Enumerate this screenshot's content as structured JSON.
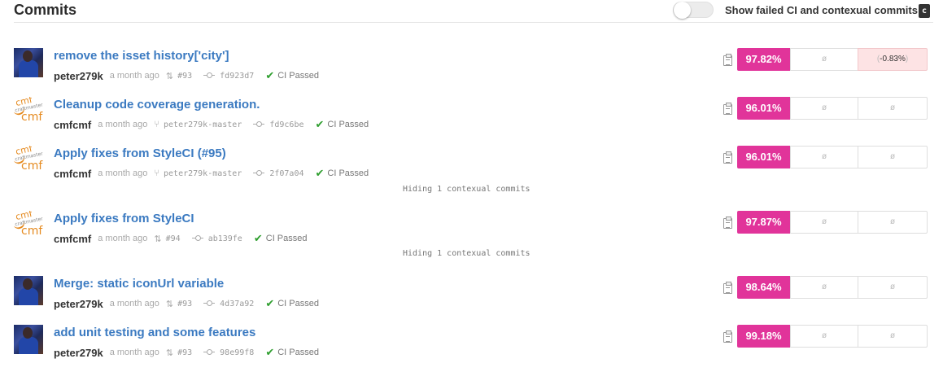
{
  "header": {
    "title": "Commits",
    "toggle_label": "Show failed CI and contexual commits",
    "shortcut_key": "c",
    "toggle_on": false
  },
  "commits": [
    {
      "title": "remove the isset history['city']",
      "author": "peter279k",
      "avatar": "photo",
      "time": "a month ago",
      "ref_icon": "pull-request-icon",
      "ref": "#93",
      "sha": "fd923d7",
      "ci": "CI Passed",
      "coverage": "97.82%",
      "col2": "ø",
      "col3": "-0.83%",
      "col3_negative": true
    },
    {
      "title": "Cleanup code coverage generation.",
      "author": "cmfcmf",
      "avatar": "cmf",
      "time": "a month ago",
      "ref_icon": "branch-icon",
      "ref": "peter279k-master",
      "sha": "fd9c6be",
      "ci": "CI Passed",
      "coverage": "96.01%",
      "col2": "ø",
      "col3": "ø",
      "col3_negative": false
    },
    {
      "title": "Apply fixes from StyleCI (#95)",
      "author": "cmfcmf",
      "avatar": "cmf",
      "time": "a month ago",
      "ref_icon": "branch-icon",
      "ref": "peter279k-master",
      "sha": "2f07a04",
      "ci": "CI Passed",
      "coverage": "96.01%",
      "col2": "ø",
      "col3": "ø",
      "col3_negative": false
    },
    {
      "title": "Apply fixes from StyleCI",
      "author": "cmfcmf",
      "avatar": "cmf",
      "time": "a month ago",
      "ref_icon": "pull-request-icon",
      "ref": "#94",
      "sha": "ab139fe",
      "ci": "CI Passed",
      "coverage": "97.87%",
      "col2": "ø",
      "col3": "ø",
      "col3_negative": false
    },
    {
      "title": "Merge: static iconUrl variable",
      "author": "peter279k",
      "avatar": "photo",
      "time": "a month ago",
      "ref_icon": "pull-request-icon",
      "ref": "#93",
      "sha": "4d37a92",
      "ci": "CI Passed",
      "coverage": "98.64%",
      "col2": "ø",
      "col3": "ø",
      "col3_negative": false
    },
    {
      "title": "add unit testing and some features",
      "author": "peter279k",
      "avatar": "photo",
      "time": "a month ago",
      "ref_icon": "pull-request-icon",
      "ref": "#93",
      "sha": "98e99f8",
      "ci": "CI Passed",
      "coverage": "99.18%",
      "col2": "ø",
      "col3": "ø",
      "col3_negative": false
    }
  ],
  "hidden_notes": [
    "Hiding 1 contexual commits",
    "Hiding 1 contexual commits"
  ],
  "colors": {
    "coverage_badge": "#e1349a",
    "link": "#3b7ac1",
    "ci_check": "#2e9e2e",
    "negative_bg": "#fde3e4"
  }
}
